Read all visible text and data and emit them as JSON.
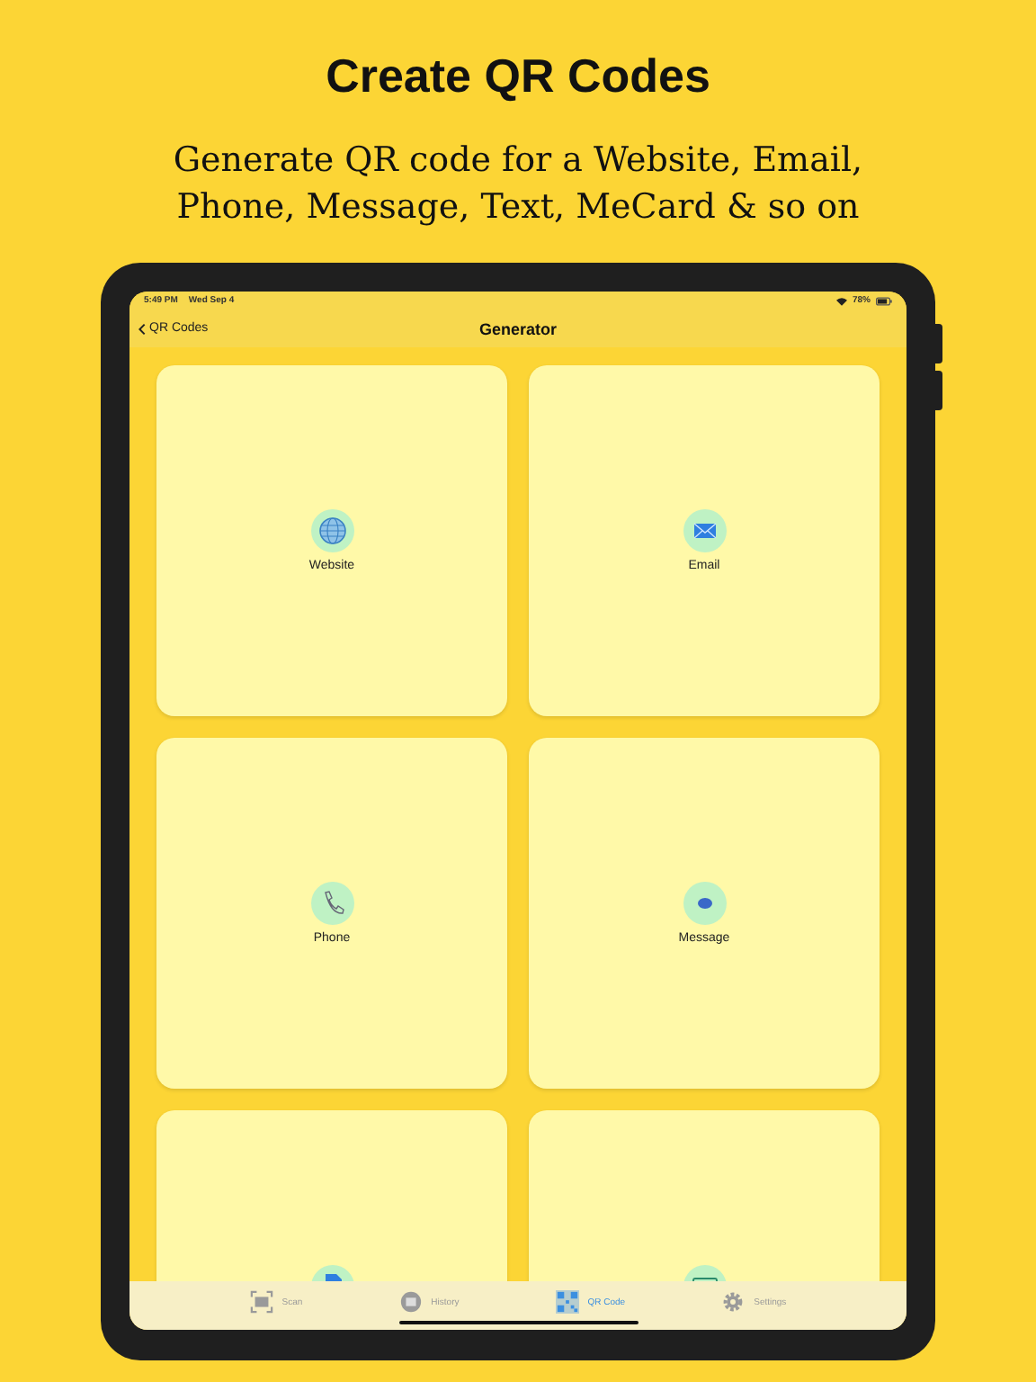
{
  "headline": "Create QR Codes",
  "subtitle": "Generate QR code for a Website, Email, Phone, Message, Text, MeCard & so on",
  "status_bar": {
    "time": "5:49 PM",
    "date": "Wed Sep 4",
    "battery": "78%"
  },
  "nav_bar": {
    "back": "QR Codes",
    "title": "Generator"
  },
  "tiles": [
    {
      "kind": "globe",
      "label": "Website"
    },
    {
      "kind": "envelope",
      "label": "Email"
    },
    {
      "kind": "phone",
      "label": "Phone"
    },
    {
      "kind": "bubble",
      "label": "Message"
    },
    {
      "kind": "document"
    },
    {
      "kind": "card"
    }
  ],
  "tab_bar": [
    {
      "label": "Scan",
      "selected": false
    },
    {
      "label": "History",
      "selected": false
    },
    {
      "label": "QR Code",
      "selected": true
    },
    {
      "label": "Settings",
      "selected": false
    }
  ]
}
